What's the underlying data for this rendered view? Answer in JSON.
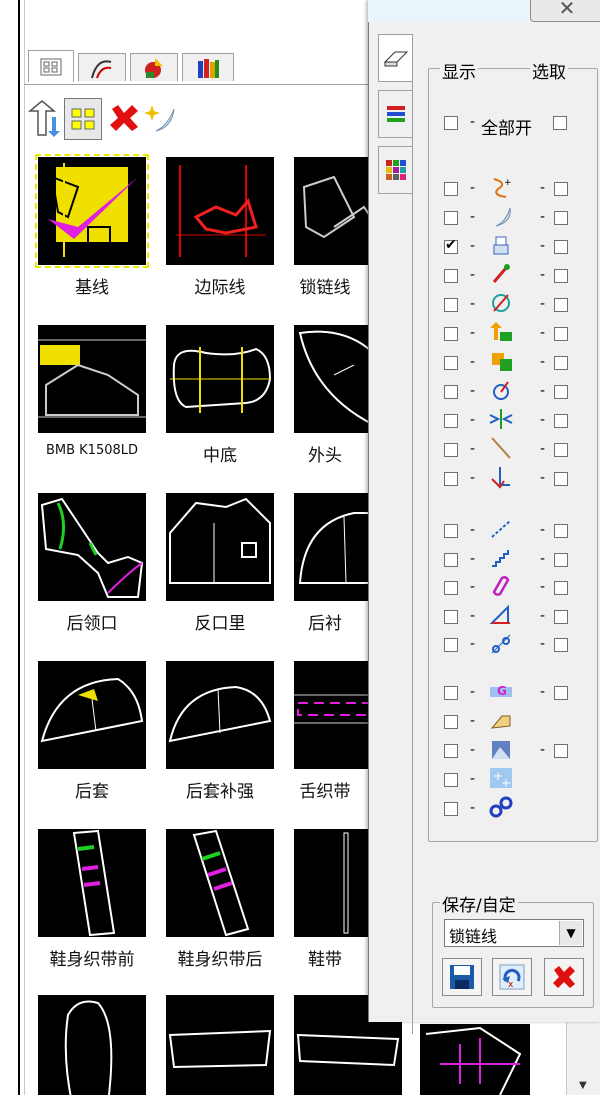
{
  "window": {
    "close_label": "✕"
  },
  "library": {
    "tabs": [
      {
        "name": "grid-tab",
        "icon": "grid-icon"
      },
      {
        "name": "curve-tab",
        "icon": "curve-icon"
      },
      {
        "name": "shapes-tab",
        "icon": "shapes-icon"
      },
      {
        "name": "books-tab",
        "icon": "books-icon"
      }
    ],
    "toolbar": [
      "sort-icon",
      "thumbnail-view-icon",
      "delete-icon",
      "magic-icon"
    ],
    "items": [
      {
        "label": "基线"
      },
      {
        "label": "边际线"
      },
      {
        "label": "锁链线"
      },
      {
        "label": "BMB K1508LD"
      },
      {
        "label": "中底"
      },
      {
        "label": "外头"
      },
      {
        "label": "后领口"
      },
      {
        "label": "反口里"
      },
      {
        "label": "后衬"
      },
      {
        "label": "后套"
      },
      {
        "label": "后套补强"
      },
      {
        "label": "舌织带"
      },
      {
        "label": "鞋身织带前"
      },
      {
        "label": "鞋身织带后"
      },
      {
        "label": "鞋带"
      }
    ]
  },
  "layer_panel": {
    "display_label": "显示",
    "select_label": "选取",
    "all_on_label": "全部开",
    "vertical_tabs": [
      "eraser-icon",
      "layers-icon",
      "palette-icon"
    ],
    "rows_group1": [
      {
        "icon": "point-curve-icon",
        "display": false,
        "select": false
      },
      {
        "icon": "moon-arrow-icon",
        "display": false,
        "select": false
      },
      {
        "icon": "stamp-icon",
        "display": true,
        "select": false
      },
      {
        "icon": "pin-icon",
        "display": false,
        "select": false
      },
      {
        "icon": "compass-icon",
        "display": false,
        "select": false
      },
      {
        "icon": "stack-arrow-icon",
        "display": false,
        "select": false
      },
      {
        "icon": "copy-arrow-icon",
        "display": false,
        "select": false
      },
      {
        "icon": "needle-icon",
        "display": false,
        "select": false
      },
      {
        "icon": "merge-arrows-icon",
        "display": false,
        "select": false
      },
      {
        "icon": "diagonal-line-icon",
        "display": false,
        "select": false
      },
      {
        "icon": "corner-arrow-icon",
        "display": false,
        "select": false
      }
    ],
    "rows_group2": [
      {
        "icon": "stitch-icon",
        "display": false,
        "select": false
      },
      {
        "icon": "staircase-icon",
        "display": false,
        "select": false
      },
      {
        "icon": "rounded-shape-icon",
        "display": false,
        "select": false
      },
      {
        "icon": "triangle-ruler-icon",
        "display": false,
        "select": false
      },
      {
        "icon": "dot-line-icon",
        "display": false,
        "select": false
      }
    ],
    "rows_group3": [
      {
        "icon": "g-symbol-icon",
        "display": false,
        "select": false,
        "has_select": true
      },
      {
        "icon": "tag-icon",
        "display": false,
        "select": false,
        "has_select": false
      },
      {
        "icon": "photo-icon",
        "display": false,
        "select": false,
        "has_select": true
      },
      {
        "icon": "plus-grid-icon",
        "display": false,
        "select": false,
        "has_select": false
      },
      {
        "icon": "circles-icon",
        "display": false,
        "select": false,
        "has_select": false
      }
    ],
    "save_group_label": "保存/自定",
    "combo_value": "锁链线",
    "buttons": [
      "save-icon",
      "reload-icon",
      "delete-icon"
    ]
  }
}
